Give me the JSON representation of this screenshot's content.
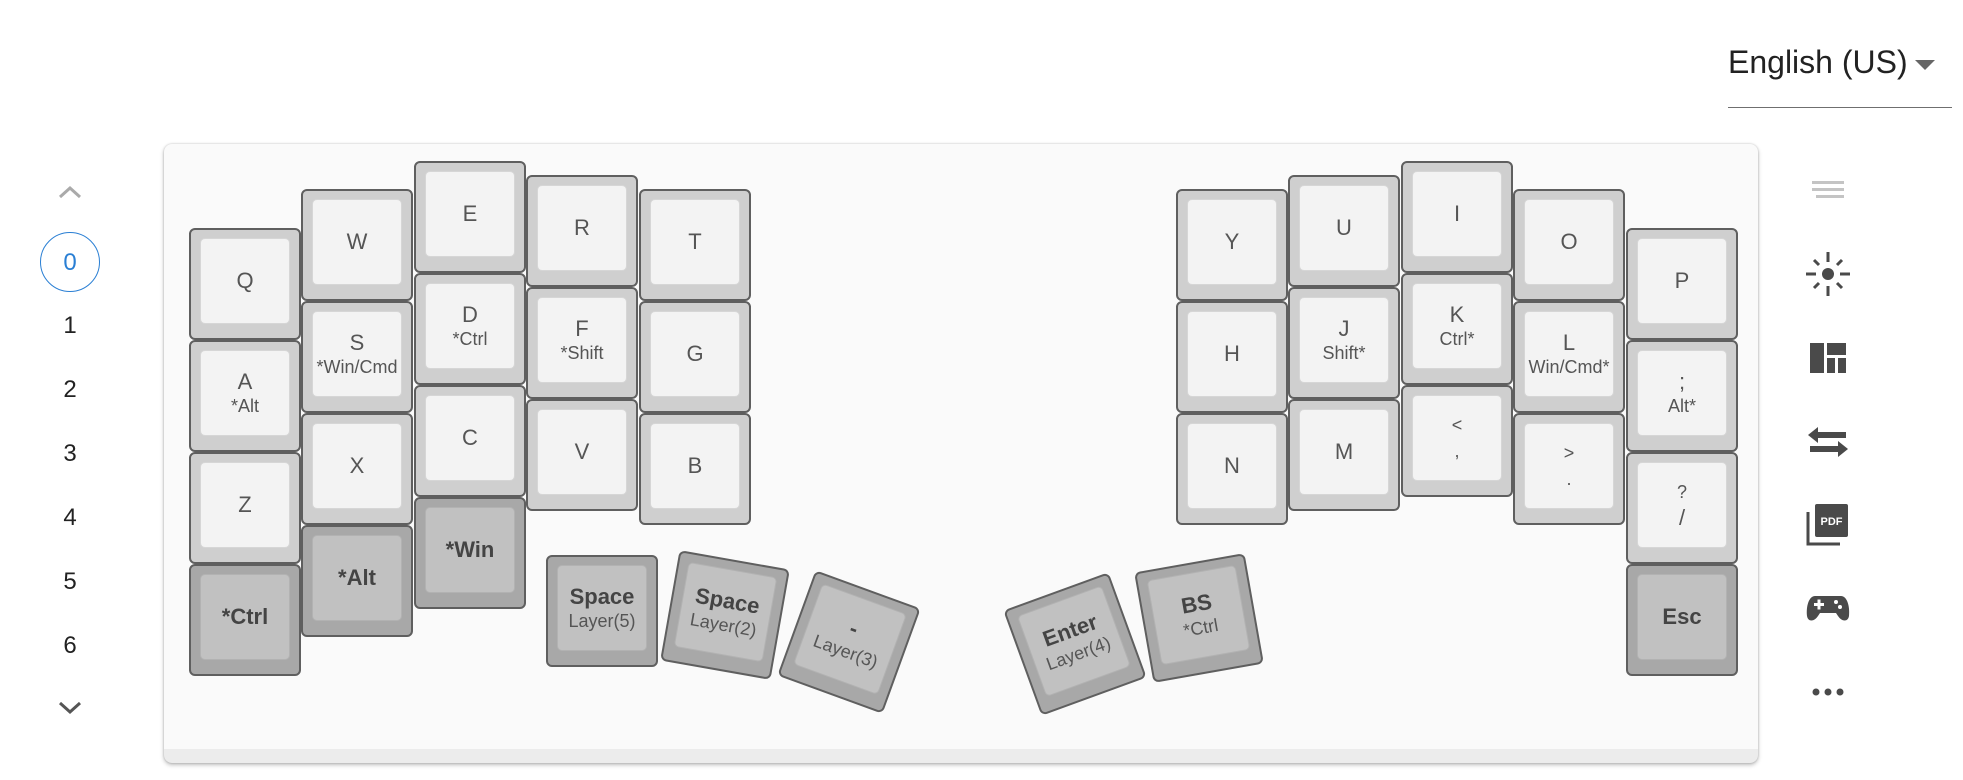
{
  "language": {
    "label": "English (US)"
  },
  "layers": {
    "active": "0",
    "items": [
      "0",
      "1",
      "2",
      "3",
      "4",
      "5",
      "6"
    ]
  },
  "keys": {
    "q": {
      "main": "Q"
    },
    "w": {
      "main": "W"
    },
    "e": {
      "main": "E"
    },
    "r": {
      "main": "R"
    },
    "t": {
      "main": "T"
    },
    "a": {
      "main": "A",
      "sub": "*Alt"
    },
    "s": {
      "main": "S",
      "sub": "*Win/Cmd"
    },
    "d": {
      "main": "D",
      "sub": "*Ctrl"
    },
    "f": {
      "main": "F",
      "sub": "*Shift"
    },
    "g": {
      "main": "G"
    },
    "z": {
      "main": "Z"
    },
    "x": {
      "main": "X"
    },
    "c": {
      "main": "C"
    },
    "v": {
      "main": "V"
    },
    "b": {
      "main": "B"
    },
    "lctrl": {
      "main": "*Ctrl"
    },
    "lalt": {
      "main": "*Alt"
    },
    "lwin": {
      "main": "*Win"
    },
    "space1": {
      "main": "Space",
      "sub": "Layer(5)"
    },
    "space2": {
      "main": "Space",
      "sub": "Layer(2)"
    },
    "minus": {
      "main": "-",
      "sub": "Layer(3)"
    },
    "enter": {
      "main": "Enter",
      "sub": "Layer(4)"
    },
    "bs": {
      "main": "BS",
      "sub": "*Ctrl"
    },
    "y": {
      "main": "Y"
    },
    "u": {
      "main": "U"
    },
    "i": {
      "main": "I"
    },
    "o": {
      "main": "O"
    },
    "p": {
      "main": "P"
    },
    "h": {
      "main": "H"
    },
    "j": {
      "main": "J",
      "sub": "Shift*"
    },
    "k": {
      "main": "K",
      "sub": "Ctrl*"
    },
    "l": {
      "main": "L",
      "sub": "Win/Cmd*"
    },
    "semi": {
      "top": ";",
      "sub": "Alt*"
    },
    "n": {
      "main": "N"
    },
    "m": {
      "main": "M"
    },
    "comma": {
      "top": "<",
      "bottom": ","
    },
    "period": {
      "top": ">",
      "bottom": "."
    },
    "slash": {
      "top": "?",
      "bottom": "/"
    },
    "esc": {
      "main": "Esc"
    }
  },
  "toolbar": {
    "icons": [
      "text-lines-icon",
      "brightness-icon",
      "layout-icon",
      "swap-icon",
      "pdf-icon",
      "gamepad-icon",
      "more-icon"
    ]
  },
  "colors": {
    "accent": "#2a7fd4",
    "key_border": "#5f5f5f",
    "mod_key": "#a8a8a8"
  }
}
